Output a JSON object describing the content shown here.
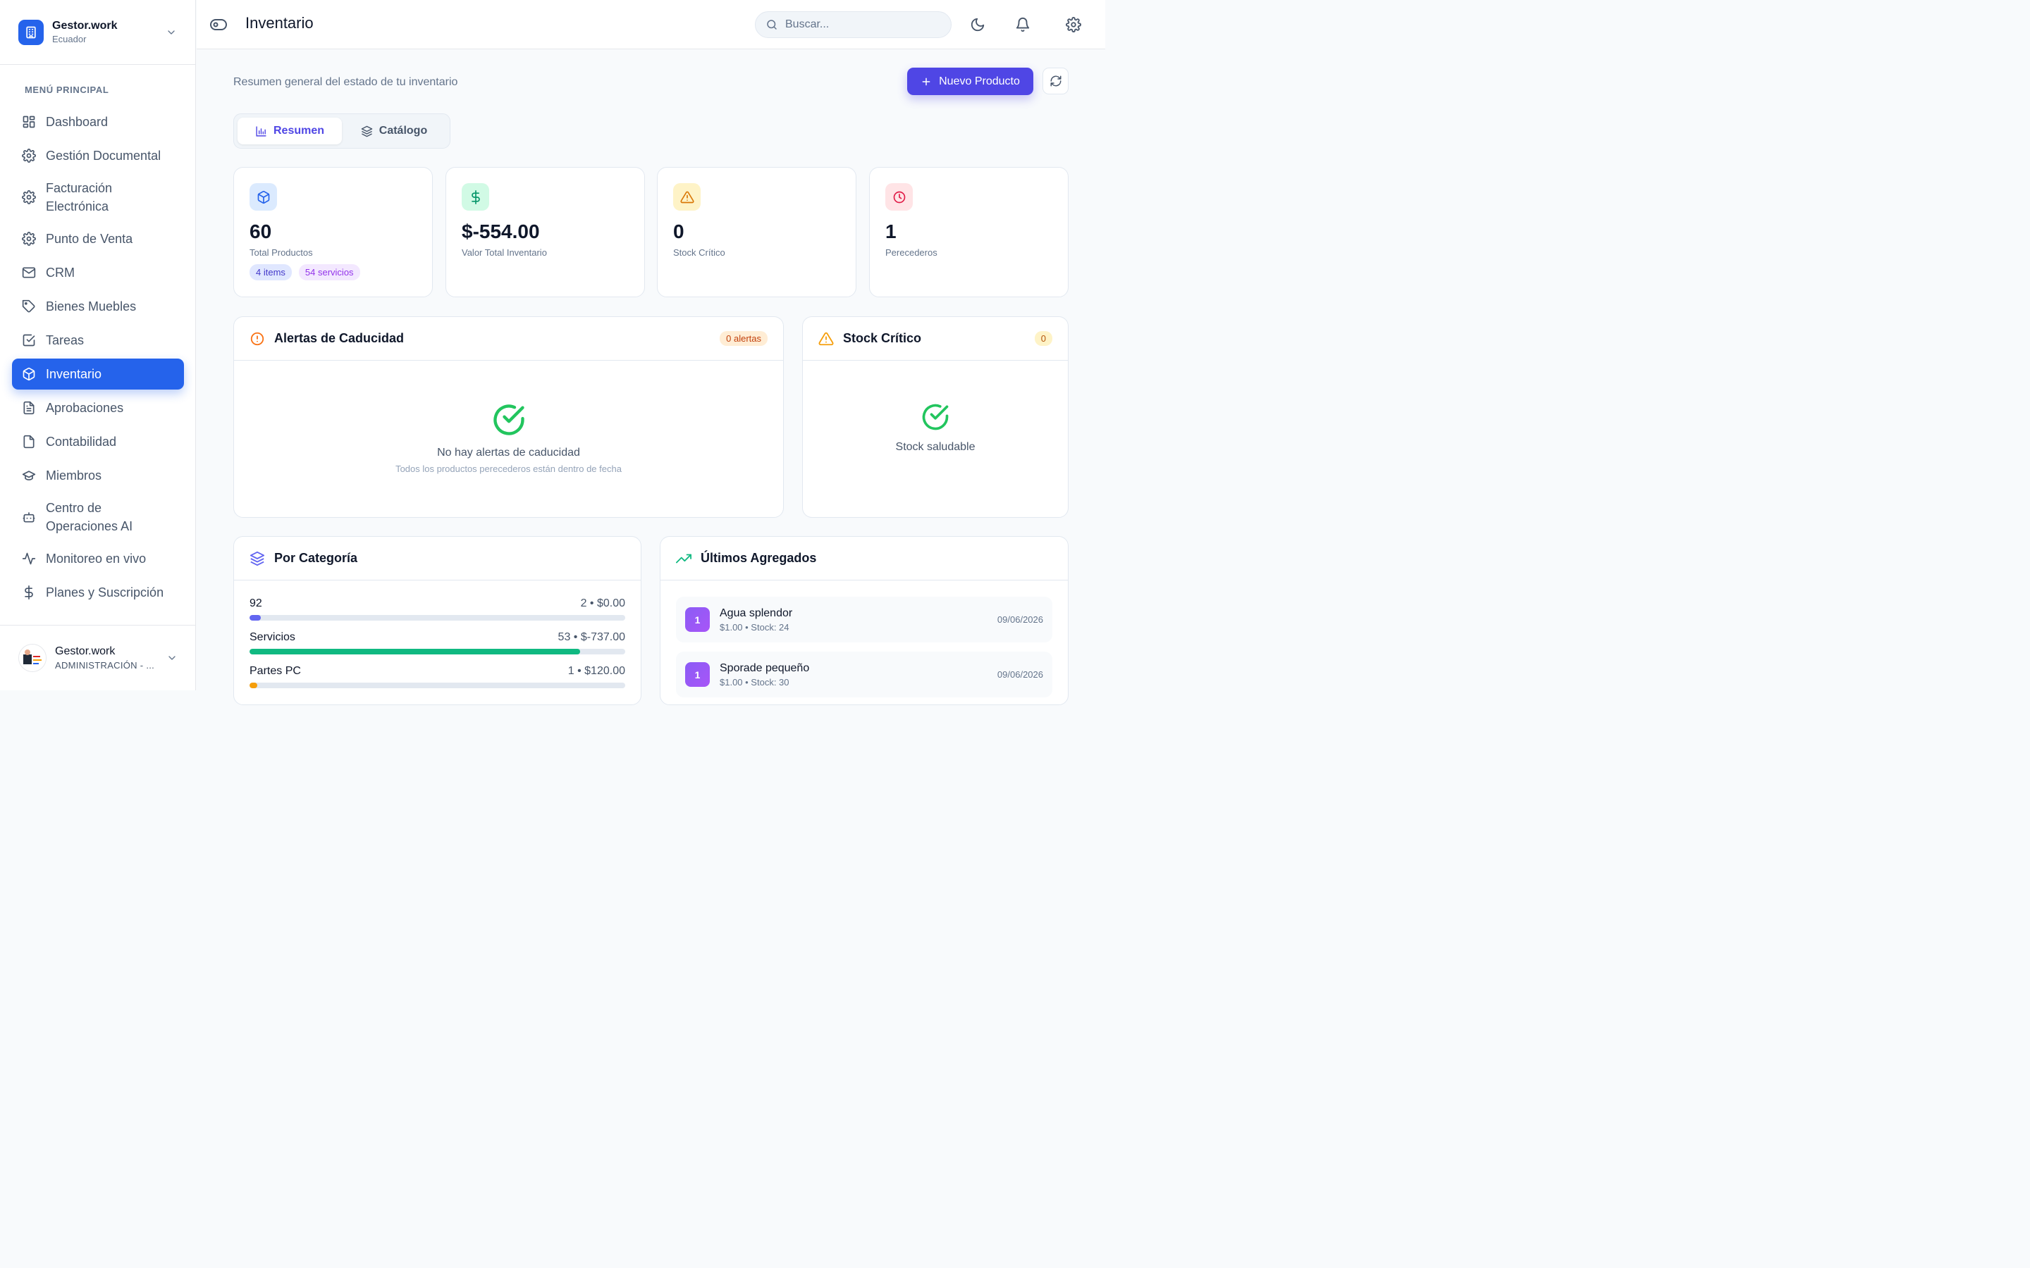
{
  "colors": {
    "primary": "#2563eb",
    "accent": "#4f46e5",
    "success": "#22c55e",
    "warning": "#f59e0b",
    "danger": "#e11d48",
    "purple": "#8b5cf6"
  },
  "sidebar": {
    "brand_name": "Gestor.work",
    "brand_sub": "Ecuador",
    "menu_title": "MENÚ PRINCIPAL",
    "items": [
      {
        "label": "Dashboard",
        "icon": "grid-icon"
      },
      {
        "label": "Gestión Documental",
        "icon": "gear-icon"
      },
      {
        "label": "Facturación Electrónica",
        "icon": "gear-icon"
      },
      {
        "label": "Punto de Venta",
        "icon": "gear-icon"
      },
      {
        "label": "CRM",
        "icon": "mail-icon"
      },
      {
        "label": "Bienes Muebles",
        "icon": "tag-icon"
      },
      {
        "label": "Tareas",
        "icon": "checkbox-icon"
      },
      {
        "label": "Inventario",
        "icon": "box-icon"
      },
      {
        "label": "Aprobaciones",
        "icon": "file-text-icon"
      },
      {
        "label": "Contabilidad",
        "icon": "file-icon"
      },
      {
        "label": "Miembros",
        "icon": "graduation-cap-icon"
      },
      {
        "label": "Centro de Operaciones AI",
        "icon": "bot-icon"
      },
      {
        "label": "Monitoreo en vivo",
        "icon": "activity-icon"
      },
      {
        "label": "Planes y Suscripción",
        "icon": "dollar-icon"
      }
    ],
    "active_item": "Inventario",
    "user_name": "Gestor.work",
    "user_role": "ADMINISTRACIÓN - ..."
  },
  "topbar": {
    "title": "Inventario",
    "search_placeholder": "Buscar..."
  },
  "main": {
    "subtitle": "Resumen general del estado de tu inventario",
    "new_button": "Nuevo Producto",
    "tabs": [
      {
        "label": "Resumen",
        "icon": "bar-chart-icon"
      },
      {
        "label": "Catálogo",
        "icon": "layers-icon"
      }
    ],
    "stats": [
      {
        "value": "60",
        "label": "Total Productos",
        "icon": "box-icon",
        "pills": [
          "4 items",
          "54 servicios"
        ]
      },
      {
        "value": "$-554.00",
        "label": "Valor Total Inventario",
        "icon": "dollar-icon"
      },
      {
        "value": "0",
        "label": "Stock Crítico",
        "icon": "warning-icon"
      },
      {
        "value": "1",
        "label": "Perecederos",
        "icon": "clock-icon"
      }
    ],
    "expiry": {
      "title": "Alertas de Caducidad",
      "badge": "0 alertas",
      "empty_main": "No hay alertas de caducidad",
      "empty_sub": "Todos los productos perecederos están dentro de fecha"
    },
    "stock": {
      "title": "Stock Crítico",
      "badge": "0",
      "empty_main": "Stock saludable"
    },
    "categories": {
      "title": "Por Categoría",
      "rows": [
        {
          "name": "92",
          "meta": "2 • $0.00",
          "fraction": 0.03,
          "color": "#6366f1"
        },
        {
          "name": "Servicios",
          "meta": "53 • $-737.00",
          "fraction": 0.88,
          "color": "#10b981"
        },
        {
          "name": "Partes PC",
          "meta": "1 • $120.00",
          "fraction": 0.02,
          "color": "#f59e0b"
        }
      ]
    },
    "recent": {
      "title": "Últimos Agregados",
      "items": [
        {
          "badge": "1",
          "name": "Agua splendor",
          "meta": "$1.00 • Stock: 24",
          "date": "09/06/2026"
        },
        {
          "badge": "1",
          "name": "Sporade pequeño",
          "meta": "$1.00 • Stock: 30",
          "date": "09/06/2026"
        }
      ]
    }
  }
}
